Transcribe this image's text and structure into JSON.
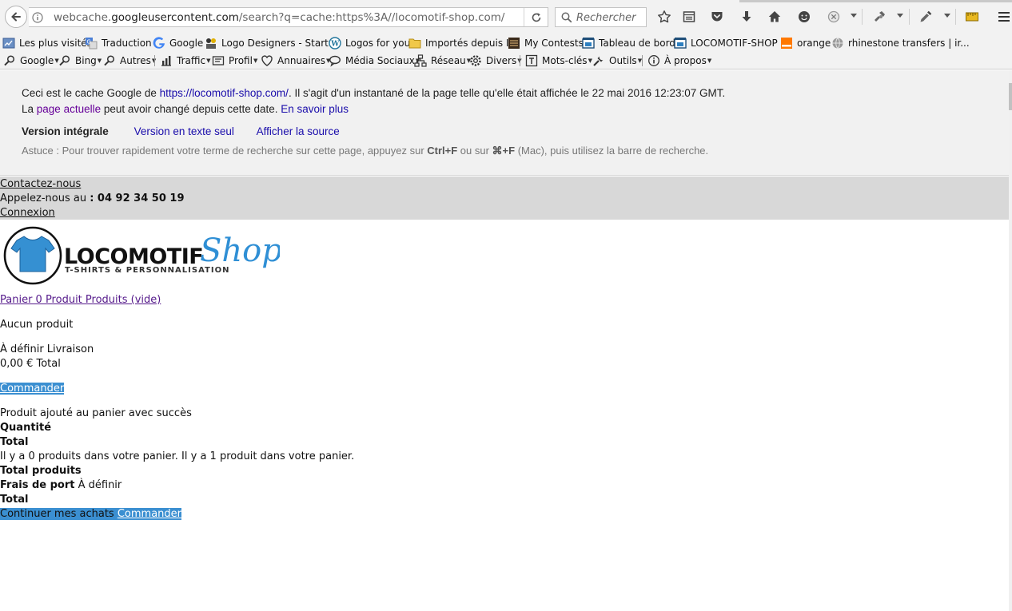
{
  "browser": {
    "url_prefix": "webcache.",
    "url_domain": "googleusercontent.com",
    "url_rest": "/search?q=cache:https%3A//locomotif-shop.com/",
    "search_placeholder": "Rechercher"
  },
  "bookmarks": [
    {
      "label": "Les plus visités",
      "icon": "most-visited-icon"
    },
    {
      "label": "Traduction",
      "icon": "translate-icon"
    },
    {
      "label": "Google",
      "icon": "google-icon"
    },
    {
      "label": "Logo Designers - Start ...",
      "icon": "logo-designers-icon"
    },
    {
      "label": "Logos for you",
      "icon": "wordpress-icon"
    },
    {
      "label": "Importés depuis IE",
      "icon": "folder-icon"
    },
    {
      "label": "My Contests",
      "icon": "contests-icon"
    },
    {
      "label": "Tableau de bord",
      "icon": "dashboard-icon"
    },
    {
      "label": "LOCOMOTIF-SHOP",
      "icon": "shop-icon"
    },
    {
      "label": "orange",
      "icon": "orange-icon"
    },
    {
      "label": "rhinestone transfers | ir...",
      "icon": "globe-icon"
    }
  ],
  "menus": [
    {
      "label": "Google",
      "icon": "search-icon"
    },
    {
      "label": "Bing",
      "icon": "search-icon"
    },
    {
      "label": "Autres",
      "icon": "search-icon"
    },
    {
      "label": "Traffic",
      "icon": "chart-icon"
    },
    {
      "label": "Profil",
      "icon": "profile-icon"
    },
    {
      "label": "Annuaires",
      "icon": "heart-icon"
    },
    {
      "label": "Média Sociaux",
      "icon": "speech-icon"
    },
    {
      "label": "Réseau",
      "icon": "network-icon"
    },
    {
      "label": "Divers",
      "icon": "gear-icon"
    },
    {
      "label": "Mots-clés",
      "icon": "keywords-icon"
    },
    {
      "label": "Outils",
      "icon": "tools-icon"
    },
    {
      "label": "À propos",
      "icon": "info-icon"
    }
  ],
  "cache": {
    "line1_pre": "Ceci est le cache Google de ",
    "line1_link": "https://locomotif-shop.com/",
    "line1_post": ". Il s'agit d'un instantané de la page telle qu'elle était affichée le 22 mai 2016 12:23:07 GMT.",
    "line2_pre": "La ",
    "line2_link": "page actuelle",
    "line2_mid": " peut avoir changé depuis cette date. ",
    "line2_link2": "En savoir plus",
    "version_full": "Version intégrale",
    "version_text": "Version en texte seul",
    "view_source": "Afficher la source",
    "tip_pre": "Astuce : Pour trouver rapidement votre terme de recherche sur cette page, appuyez sur ",
    "tip_key1": "Ctrl+F",
    "tip_mid": " ou sur ",
    "tip_key2": "⌘+F",
    "tip_post": " (Mac), puis utilisez la barre de recherche."
  },
  "page": {
    "contact": "Contactez-nous",
    "call_pre": "Appelez-nous au ",
    "call_number": ": 04 92 34 50 19",
    "login": "Connexion",
    "logo_main": "LOCOMOTIF",
    "logo_script": "Shop",
    "logo_tagline": "T-SHIRTS & PERSONNALISATION",
    "cart_link": "Panier 0 Produit Produits (vide)",
    "no_product": "Aucun produit",
    "shipping_line": "À définir Livraison",
    "total_line": "0,00 € Total",
    "order_button": "Commander",
    "added_msg": "Produit ajouté au panier avec succès",
    "quantity_label": "Quantité",
    "total_label": "Total",
    "items_msg": "Il y a 0 produits dans votre panier. Il y a 1 produit dans votre panier.",
    "total_products_label": "Total produits",
    "shipping_label": "Frais de port",
    "shipping_value": " À définir",
    "total_label_2": "Total",
    "continue_label": "Continuer mes achats",
    "order_button_2": "Commander"
  },
  "colors": {
    "highlight": "#3b8fd1",
    "logo_blue": "#2f8fd5",
    "link_blue": "#1a0dab"
  }
}
